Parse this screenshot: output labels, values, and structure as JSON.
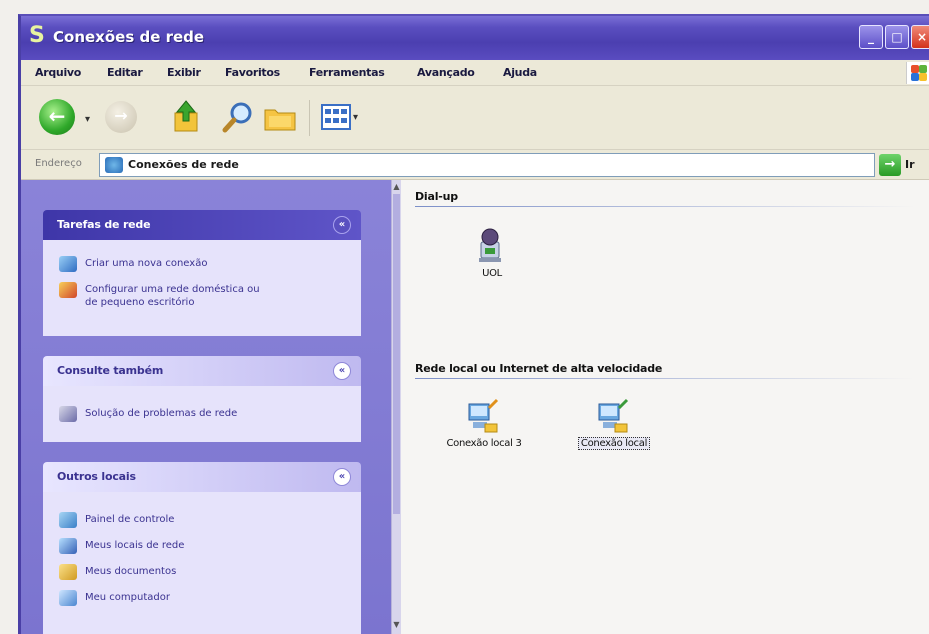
{
  "window": {
    "title": "Conexões de rede"
  },
  "menubar": {
    "items": [
      "Arquivo",
      "Editar",
      "Exibir",
      "Favoritos",
      "Ferramentas",
      "Avançado",
      "Ajuda"
    ]
  },
  "addressbar": {
    "label": "Endereço",
    "value": "Conexões de rede",
    "go_label": "Ir"
  },
  "taskpane": {
    "network_tasks": {
      "title": "Tarefas de rede",
      "items": [
        {
          "label": "Criar uma nova conexão",
          "icon": "new-connection-icon"
        },
        {
          "label": "Configurar uma rede doméstica ou",
          "label2": "de pequeno escritório",
          "icon": "home-network-icon"
        }
      ]
    },
    "see_also": {
      "title": "Consulte também",
      "items": [
        {
          "label": "Solução de problemas de rede",
          "icon": "troubleshoot-icon"
        }
      ]
    },
    "other_places": {
      "title": "Outros locais",
      "items": [
        {
          "label": "Painel de controle",
          "icon": "control-panel-icon"
        },
        {
          "label": "Meus locais de rede",
          "icon": "network-places-icon"
        },
        {
          "label": "Meus documentos",
          "icon": "my-documents-icon"
        },
        {
          "label": "Meu computador",
          "icon": "my-computer-icon"
        }
      ]
    }
  },
  "main": {
    "groups": [
      {
        "title": "Dial-up",
        "items": [
          {
            "label": "UOL",
            "icon": "dialup-connection-icon",
            "selected": false
          }
        ]
      },
      {
        "title": "Rede local ou Internet de alta velocidade",
        "items": [
          {
            "label": "Conexão local 3",
            "icon": "lan-connection-icon",
            "selected": false
          },
          {
            "label": "Conexão local",
            "icon": "lan-connection-icon",
            "selected": true
          }
        ]
      }
    ]
  }
}
